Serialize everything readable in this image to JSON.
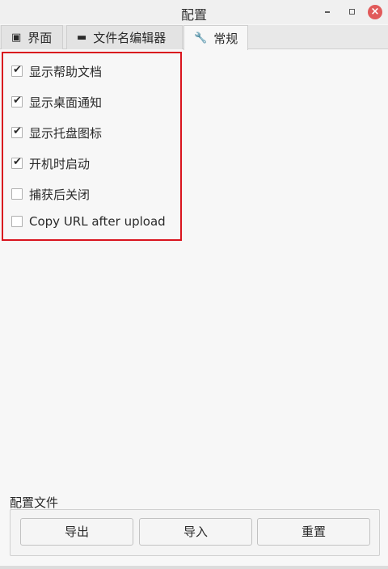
{
  "window": {
    "title": "配置"
  },
  "tabs": [
    {
      "label": "界面",
      "icon": "panel-icon"
    },
    {
      "label": "文件名编辑器",
      "icon": "text-edit-icon"
    },
    {
      "label": "常规",
      "icon": "wrench-icon",
      "active": true
    }
  ],
  "options": [
    {
      "label": "显示帮助文档",
      "checked": true
    },
    {
      "label": "显示桌面通知",
      "checked": true
    },
    {
      "label": "显示托盘图标",
      "checked": true
    },
    {
      "label": "开机时启动",
      "checked": true
    },
    {
      "label": "捕获后关闭",
      "checked": false
    },
    {
      "label": "Copy URL after upload",
      "checked": false
    }
  ],
  "config_section": {
    "label": "配置文件",
    "export_label": "导出",
    "import_label": "导入",
    "reset_label": "重置"
  },
  "colors": {
    "highlight_border": "#d9141e",
    "close_button": "#e15a5a"
  }
}
